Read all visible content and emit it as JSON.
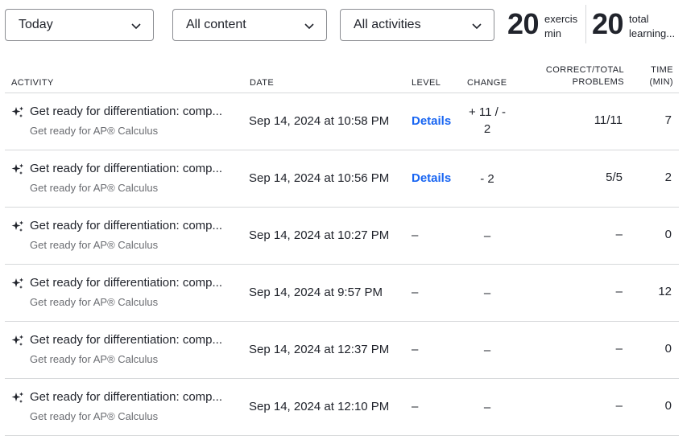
{
  "filters": {
    "date": "Today",
    "content": "All content",
    "activity": "All activities"
  },
  "stats": {
    "exercise_value": "20",
    "exercise_unit_line1": "exercis",
    "exercise_unit_line2": "min",
    "learning_value": "20",
    "learning_unit_line1": "total",
    "learning_unit_line2": "learning..."
  },
  "table": {
    "headers": {
      "activity": "ACTIVITY",
      "date": "DATE",
      "level": "LEVEL",
      "change": "CHANGE",
      "correct_line1": "CORRECT/TOTAL",
      "correct_line2": "PROBLEMS",
      "time_line1": "TIME",
      "time_line2": "(MIN)"
    },
    "rows": [
      {
        "title": "Get ready for differentiation: comp...",
        "course": "Get ready for AP® Calculus",
        "date": "Sep 14, 2024 at 10:58 PM",
        "level": "Details",
        "change_line1": "+ 11 / -",
        "change_line2": "2",
        "correct": "11/11",
        "time": "7"
      },
      {
        "title": "Get ready for differentiation: comp...",
        "course": "Get ready for AP® Calculus",
        "date": "Sep 14, 2024 at 10:56 PM",
        "level": "Details",
        "change_line1": "- 2",
        "change_line2": "",
        "correct": "5/5",
        "time": "2"
      },
      {
        "title": "Get ready for differentiation: comp...",
        "course": "Get ready for AP® Calculus",
        "date": "Sep 14, 2024 at 10:27 PM",
        "level": "–",
        "change_line1": "–",
        "change_line2": "",
        "correct": "–",
        "time": "0"
      },
      {
        "title": "Get ready for differentiation: comp...",
        "course": "Get ready for AP® Calculus",
        "date": "Sep 14, 2024 at 9:57 PM",
        "level": "–",
        "change_line1": "–",
        "change_line2": "",
        "correct": "–",
        "time": "12"
      },
      {
        "title": "Get ready for differentiation: comp...",
        "course": "Get ready for AP® Calculus",
        "date": "Sep 14, 2024 at 12:37 PM",
        "level": "–",
        "change_line1": "–",
        "change_line2": "",
        "correct": "–",
        "time": "0"
      },
      {
        "title": "Get ready for differentiation: comp...",
        "course": "Get ready for AP® Calculus",
        "date": "Sep 14, 2024 at 12:10 PM",
        "level": "–",
        "change_line1": "–",
        "change_line2": "",
        "correct": "–",
        "time": "0"
      }
    ]
  },
  "icons": {
    "activity": "sparkle-icon",
    "dropdown": "chevron-down-icon"
  },
  "colors": {
    "link": "#1865f2",
    "text": "#21242c",
    "subtext": "#6b6d72",
    "border": "#d6d8da"
  }
}
